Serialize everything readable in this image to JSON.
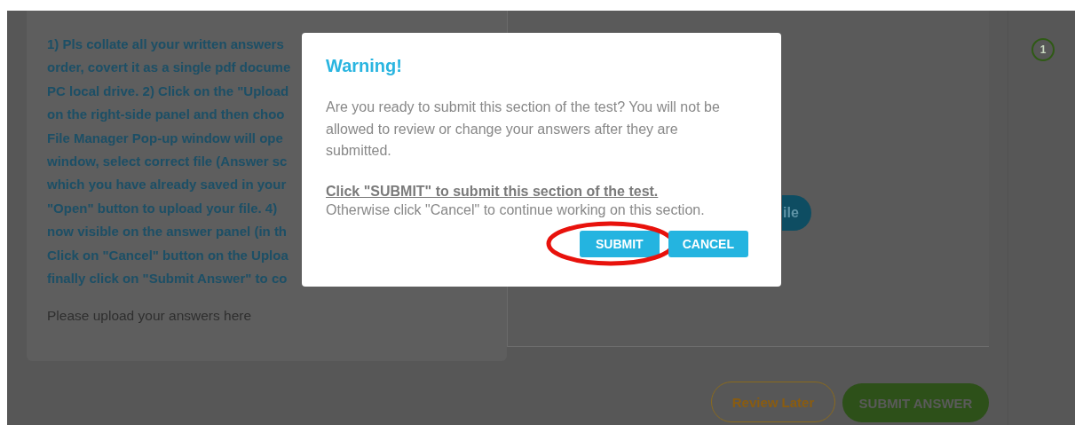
{
  "page": {
    "instructions": [
      "1) Pls collate all your written answers",
      "order, covert it as a single pdf docume",
      "PC local drive. 2) Click on the \"Upload",
      "on the right-side panel and then choo",
      "File Manager Pop-up window will ope",
      "window, select correct file (Answer sc",
      "which you have already saved in your",
      "\"Open\" button to upload your file. 4)",
      "now visible on the answer panel (in th",
      "Click on \"Cancel\" button on the Uploa",
      "finally click on \"Submit Answer\" to co"
    ],
    "upload_prompt": "Please upload your answers here",
    "upload_button": "ile",
    "question_number": "1",
    "review_button": "Review Later",
    "submit_answer_button": "SUBMIT ANSWER"
  },
  "dialog": {
    "title": "Warning!",
    "message": "Are you ready to submit this section of the test? You will not be allowed to review or change your answers after they are submitted.",
    "instruction": "Click \"SUBMIT\" to submit this section of the test.",
    "note": "Otherwise click \"Cancel\" to continue working on this section.",
    "buttons": [
      {
        "label": "SUBMIT",
        "highlighted": true
      },
      {
        "label": "CANCEL",
        "highlighted": false
      }
    ]
  }
}
